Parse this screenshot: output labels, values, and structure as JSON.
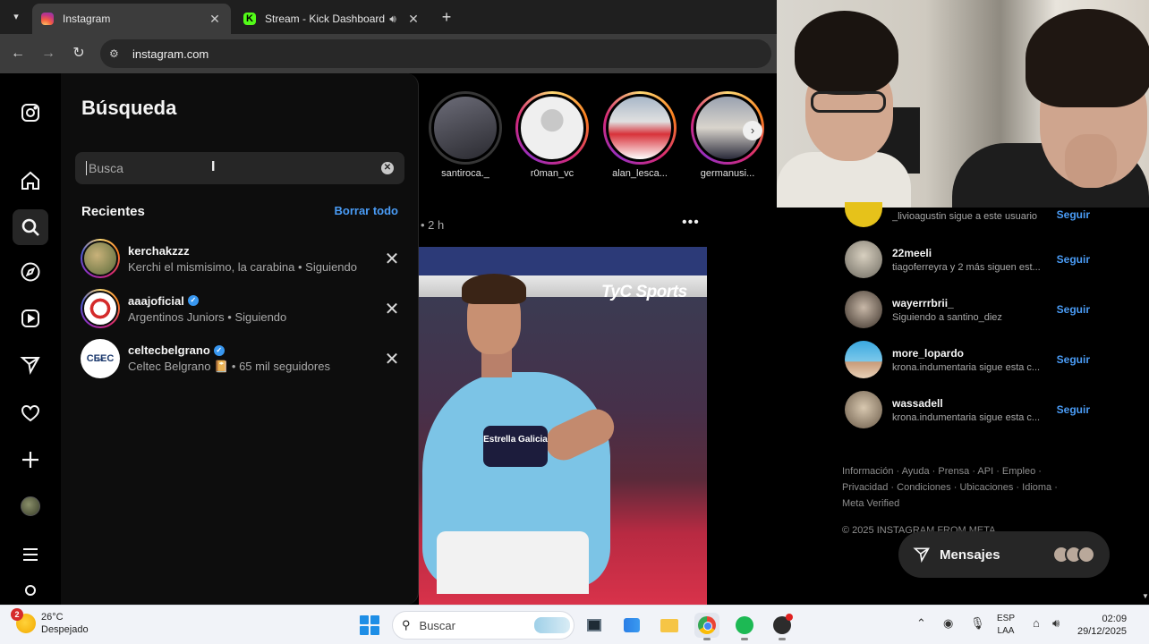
{
  "browser": {
    "tabs": [
      {
        "title": "Instagram",
        "favicon": "instagram-favicon"
      },
      {
        "title": "Stream - Kick Dashboard",
        "favicon": "kick-favicon",
        "audio": true
      }
    ],
    "url": "instagram.com"
  },
  "search_panel": {
    "title": "Búsqueda",
    "placeholder": "Busca",
    "recent_label": "Recientes",
    "clear_all_label": "Borrar todo",
    "recents": [
      {
        "username": "kerchakzzz",
        "verified": false,
        "subtitle": "Kerchi el mismisimo, la carabina • Siguiendo"
      },
      {
        "username": "aaajoficial",
        "verified": true,
        "subtitle": "Argentinos Juniors • Siguiendo"
      },
      {
        "username": "celtecbelgrano",
        "verified": true,
        "subtitle": "Celtec Belgrano  📔  • 65 mil seguidores",
        "avatar_text": "CE̶EC"
      }
    ]
  },
  "feed": {
    "stories": [
      {
        "name": "santiroca._",
        "seen": true
      },
      {
        "name": "r0man_vc",
        "seen": false
      },
      {
        "name": "alan_lesca...",
        "seen": false
      },
      {
        "name": "germanusi...",
        "seen": false
      }
    ],
    "post_time": "• 2 h",
    "post_brand": "TyC Sports",
    "post_badge": "Estrella Galicia"
  },
  "suggestions": {
    "items": [
      {
        "username": "22meeli",
        "subtitle": "tiagoferreyra y 2 más siguen est...",
        "action": "Seguir"
      },
      {
        "username": "wayerrrbrii_",
        "subtitle": "Siguiendo a santino_diez",
        "action": "Seguir"
      },
      {
        "username": "more_lopardo",
        "subtitle": "krona.indumentaria sigue esta c...",
        "action": "Seguir"
      },
      {
        "username": "wassadell",
        "subtitle": "krona.indumentaria sigue esta c...",
        "action": "Seguir"
      }
    ],
    "partial_top": {
      "subtitle": "_livioagustin sigue a este usuario",
      "action": "Seguir"
    },
    "footer_links": "Información · Ayuda · Prensa · API · Empleo · Privacidad · Condiciones · Ubicaciones · Idioma · Meta Verified",
    "copyright": "© 2025 INSTAGRAM FROM META",
    "messages_label": "Mensajes"
  },
  "taskbar": {
    "weather_temp": "26°C",
    "weather_desc": "Despejado",
    "weather_badge": "2",
    "search_placeholder": "Buscar",
    "lang_top": "ESP",
    "lang_bottom": "LAA",
    "time": "02:09",
    "date": "29/12/2025"
  },
  "colors": {
    "link_blue": "#4a9cf6",
    "ig_background": "#000000",
    "panel_background": "#0d0d0d"
  }
}
